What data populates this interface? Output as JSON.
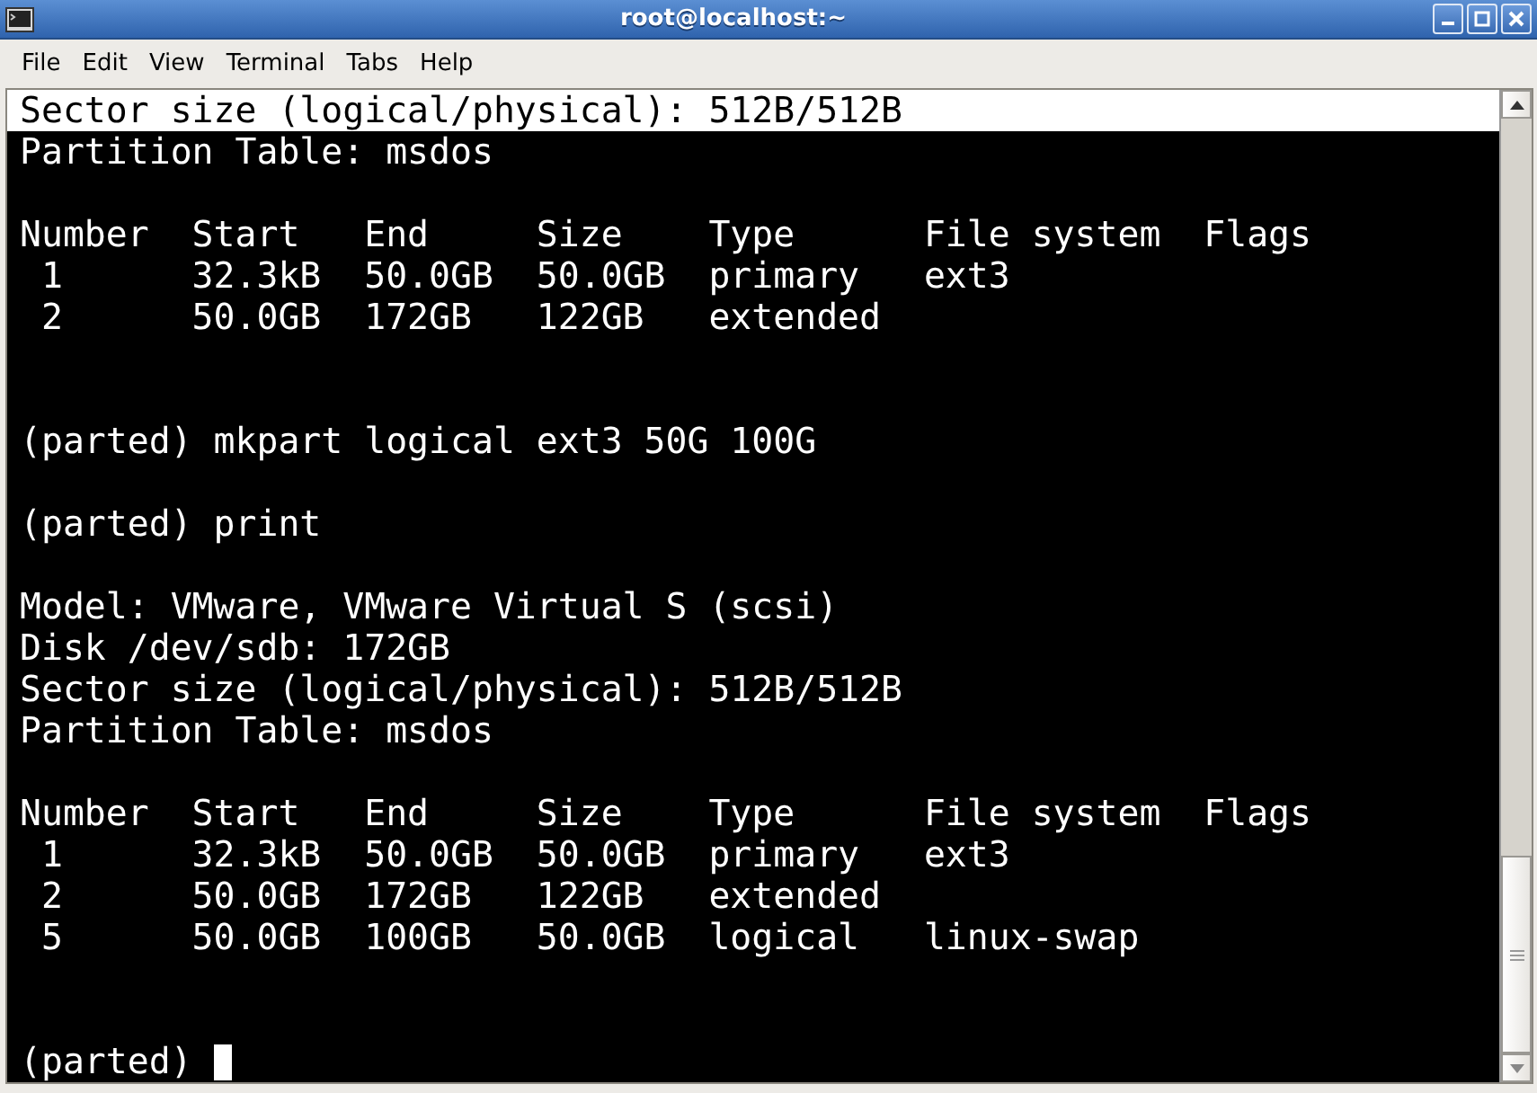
{
  "window": {
    "title": "root@localhost:~"
  },
  "menu": [
    "File",
    "Edit",
    "View",
    "Terminal",
    "Tabs",
    "Help"
  ],
  "terminal": {
    "lines": [
      {
        "kind": "text",
        "text": "Sector size (logical/physical): 512B/512B",
        "selected": true
      },
      {
        "kind": "text",
        "text": "Partition Table: msdos",
        "selected": false
      },
      {
        "kind": "blank"
      },
      {
        "kind": "text",
        "text": "Number  Start   End     Size    Type      File system  Flags",
        "selected": false
      },
      {
        "kind": "text",
        "text": " 1      32.3kB  50.0GB  50.0GB  primary   ext3",
        "selected": false
      },
      {
        "kind": "text",
        "text": " 2      50.0GB  172GB   122GB   extended",
        "selected": false
      },
      {
        "kind": "blank"
      },
      {
        "kind": "blank"
      },
      {
        "kind": "text",
        "text": "(parted) mkpart logical ext3 50G 100G",
        "selected": false
      },
      {
        "kind": "blank"
      },
      {
        "kind": "text",
        "text": "(parted) print",
        "selected": false
      },
      {
        "kind": "blank"
      },
      {
        "kind": "text",
        "text": "Model: VMware, VMware Virtual S (scsi)",
        "selected": false
      },
      {
        "kind": "text",
        "text": "Disk /dev/sdb: 172GB",
        "selected": false
      },
      {
        "kind": "text",
        "text": "Sector size (logical/physical): 512B/512B",
        "selected": false
      },
      {
        "kind": "text",
        "text": "Partition Table: msdos",
        "selected": false
      },
      {
        "kind": "blank"
      },
      {
        "kind": "text",
        "text": "Number  Start   End     Size    Type      File system  Flags",
        "selected": false
      },
      {
        "kind": "text",
        "text": " 1      32.3kB  50.0GB  50.0GB  primary   ext3",
        "selected": false
      },
      {
        "kind": "text",
        "text": " 2      50.0GB  172GB   122GB   extended",
        "selected": false
      },
      {
        "kind": "text",
        "text": " 5      50.0GB  100GB   50.0GB  logical   linux-swap",
        "selected": false
      },
      {
        "kind": "blank"
      },
      {
        "kind": "blank"
      },
      {
        "kind": "prompt",
        "text": "(parted)",
        "cursor": true
      }
    ]
  }
}
